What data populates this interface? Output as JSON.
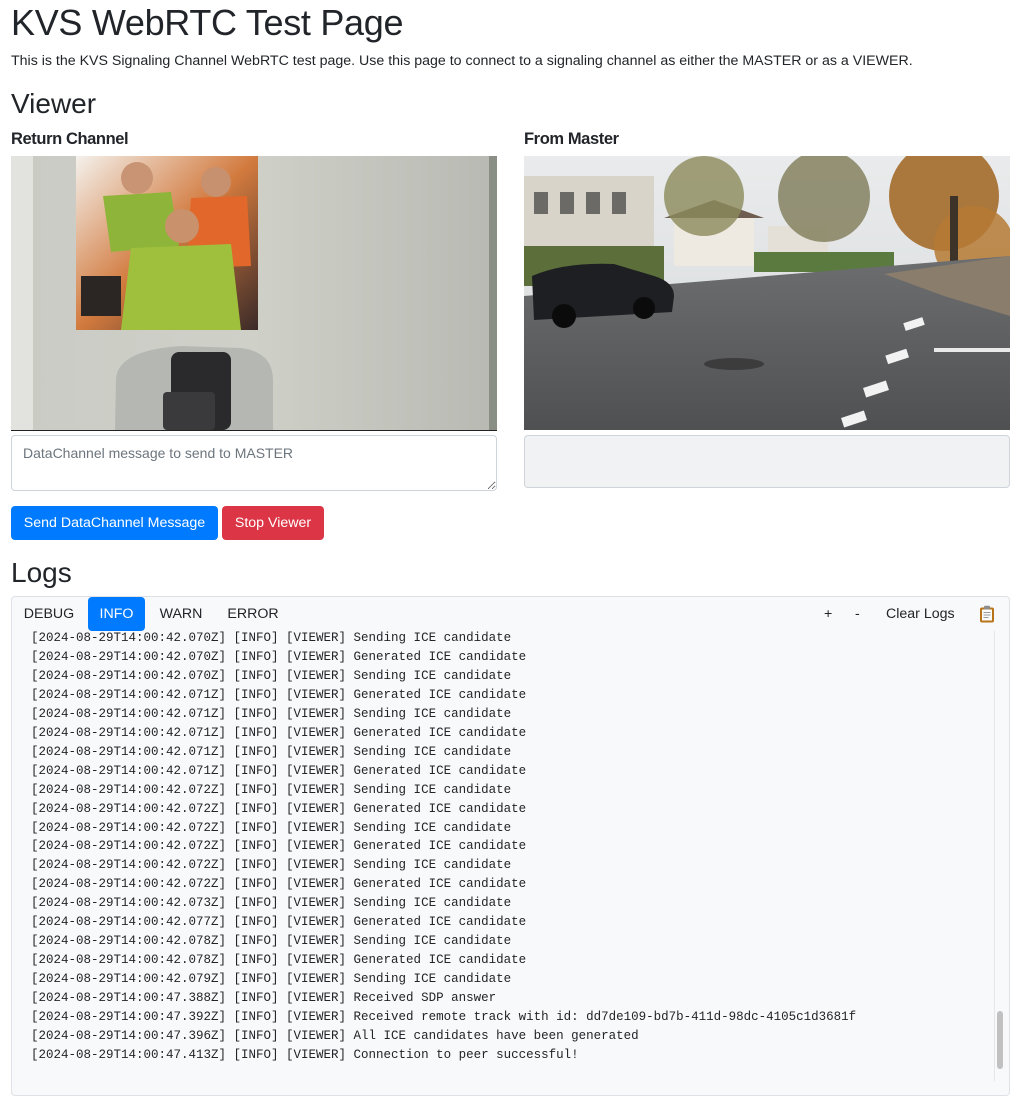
{
  "page": {
    "title": "KVS WebRTC Test Page",
    "intro": "This is the KVS Signaling Channel WebRTC test page. Use this page to connect to a signaling channel as either the MASTER or as a VIEWER."
  },
  "viewer": {
    "heading": "Viewer",
    "return_channel_label": "Return Channel",
    "from_master_label": "From Master",
    "datachannel_placeholder": "DataChannel message to send to MASTER",
    "send_button": "Send DataChannel Message",
    "stop_button": "Stop Viewer"
  },
  "logs": {
    "heading": "Logs",
    "tabs": [
      "DEBUG",
      "INFO",
      "WARN",
      "ERROR"
    ],
    "active_tab": "INFO",
    "zoom_in": "+",
    "zoom_out": "-",
    "clear": "Clear Logs",
    "copy_icon": "clipboard-icon",
    "scroll_position": 0.97,
    "lines": [
      "[2024-08-29T14:00:42.070Z] [INFO] [VIEWER] Sending ICE candidate",
      "[2024-08-29T14:00:42.070Z] [INFO] [VIEWER] Generated ICE candidate",
      "[2024-08-29T14:00:42.070Z] [INFO] [VIEWER] Sending ICE candidate",
      "[2024-08-29T14:00:42.071Z] [INFO] [VIEWER] Generated ICE candidate",
      "[2024-08-29T14:00:42.071Z] [INFO] [VIEWER] Sending ICE candidate",
      "[2024-08-29T14:00:42.071Z] [INFO] [VIEWER] Generated ICE candidate",
      "[2024-08-29T14:00:42.071Z] [INFO] [VIEWER] Sending ICE candidate",
      "[2024-08-29T14:00:42.071Z] [INFO] [VIEWER] Generated ICE candidate",
      "[2024-08-29T14:00:42.072Z] [INFO] [VIEWER] Sending ICE candidate",
      "[2024-08-29T14:00:42.072Z] [INFO] [VIEWER] Generated ICE candidate",
      "[2024-08-29T14:00:42.072Z] [INFO] [VIEWER] Sending ICE candidate",
      "[2024-08-29T14:00:42.072Z] [INFO] [VIEWER] Generated ICE candidate",
      "[2024-08-29T14:00:42.072Z] [INFO] [VIEWER] Sending ICE candidate",
      "[2024-08-29T14:00:42.072Z] [INFO] [VIEWER] Generated ICE candidate",
      "[2024-08-29T14:00:42.073Z] [INFO] [VIEWER] Sending ICE candidate",
      "[2024-08-29T14:00:42.077Z] [INFO] [VIEWER] Generated ICE candidate",
      "[2024-08-29T14:00:42.078Z] [INFO] [VIEWER] Sending ICE candidate",
      "[2024-08-29T14:00:42.078Z] [INFO] [VIEWER] Generated ICE candidate",
      "[2024-08-29T14:00:42.079Z] [INFO] [VIEWER] Sending ICE candidate",
      "[2024-08-29T14:00:47.388Z] [INFO] [VIEWER] Received SDP answer",
      "[2024-08-29T14:00:47.392Z] [INFO] [VIEWER] Received remote track with id: dd7de109-bd7b-411d-98dc-4105c1d3681f",
      "[2024-08-29T14:00:47.396Z] [INFO] [VIEWER] All ICE candidates have been generated",
      "[2024-08-29T14:00:47.413Z] [INFO] [VIEWER] Connection to peer successful!"
    ]
  },
  "colors": {
    "primary": "#007bff",
    "danger": "#dc3545",
    "panel_bg": "#f8f9fa",
    "border": "#dee2e6"
  }
}
